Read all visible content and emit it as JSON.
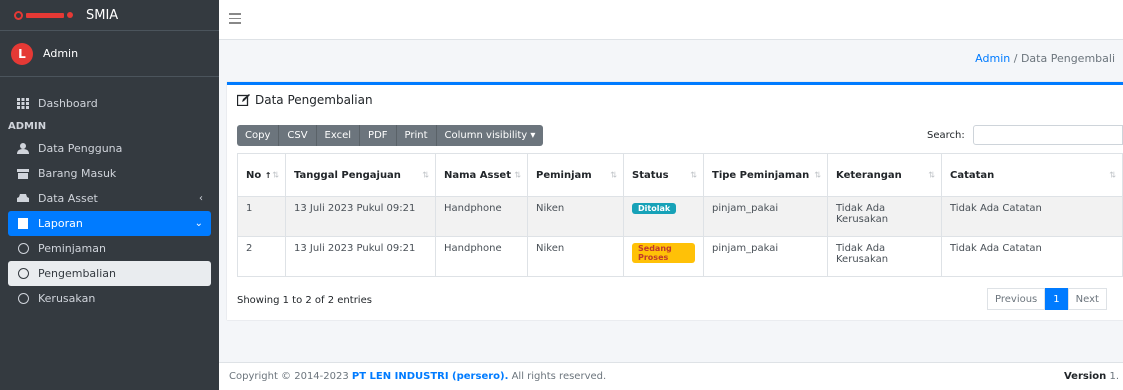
{
  "brand": {
    "name": "SMIA"
  },
  "user": {
    "name": "Admin",
    "initial": "L"
  },
  "sidebar": {
    "items": [
      {
        "label": "Dashboard"
      },
      {
        "header": "ADMIN"
      },
      {
        "label": "Data Pengguna"
      },
      {
        "label": "Barang Masuk"
      },
      {
        "label": "Data Asset"
      },
      {
        "label": "Laporan"
      },
      {
        "label": "Peminjaman"
      },
      {
        "label": "Pengembalian"
      },
      {
        "label": "Kerusakan"
      }
    ]
  },
  "breadcrumb": {
    "home": "Admin",
    "separator": "/",
    "current": "Data Pengembali"
  },
  "card": {
    "title": "Data Pengembalian",
    "buttons": [
      "Copy",
      "CSV",
      "Excel",
      "PDF",
      "Print",
      "Column visibility ▾"
    ],
    "search_label": "Search:",
    "search_value": ""
  },
  "table": {
    "headers": {
      "no": "No",
      "tanggal": "Tanggal Pengajuan",
      "nama_asset": "Nama Asset",
      "peminjam": "Peminjam",
      "status": "Status",
      "tipe": "Tipe Peminjaman",
      "keterangan": "Keterangan",
      "catatan": "Catatan"
    },
    "rows": [
      {
        "no": "1",
        "tanggal": "13 Juli 2023 Pukul 09:21",
        "nama_asset": "Handphone",
        "peminjam": "Niken",
        "status": "Ditolak",
        "tipe": "pinjam_pakai",
        "keterangan": "Tidak Ada Kerusakan",
        "catatan": "Tidak Ada Catatan"
      },
      {
        "no": "2",
        "tanggal": "13 Juli 2023 Pukul 09:21",
        "nama_asset": "Handphone",
        "peminjam": "Niken",
        "status": "Sedang Proses",
        "tipe": "pinjam_pakai",
        "keterangan": "Tidak Ada Kerusakan",
        "catatan": "Tidak Ada Catatan"
      }
    ],
    "info": "Showing 1 to 2 of 2 entries"
  },
  "pagination": {
    "previous": "Previous",
    "current": "1",
    "next": "Next"
  },
  "footer": {
    "copyright_prefix": "Copyright © 2014-2023",
    "company": "PT LEN INDUSTRI (persero).",
    "suffix": "All rights reserved.",
    "version_label": "Version",
    "version_value": "1."
  },
  "colors": {
    "sidebar_bg": "#343a40",
    "accent": "#007bff",
    "badge_ditolak": "#17a2b8",
    "badge_proses": "#ffc107"
  }
}
